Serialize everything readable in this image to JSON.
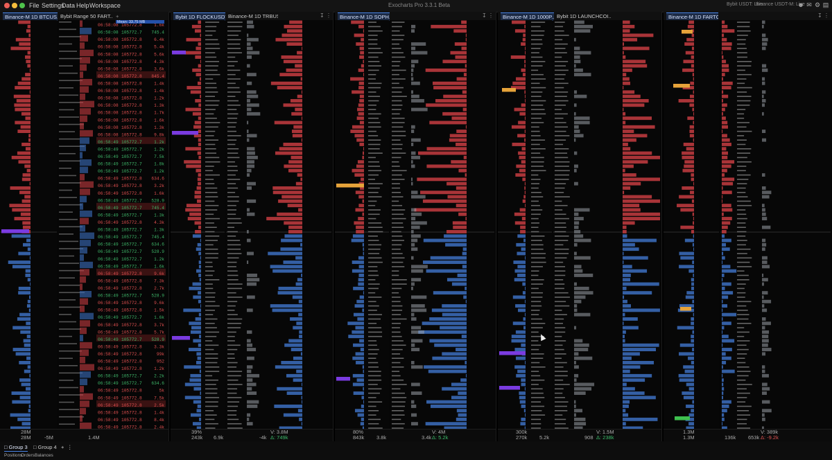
{
  "app": {
    "title": "Exocharts Pro 3.3.1 Beta",
    "menu": [
      "File",
      "Settings",
      "Data",
      "Help",
      "Workspace"
    ],
    "connection_1": "Bybit USDT: Live",
    "connection_2": "Binance USDT-M: Live"
  },
  "colors": {
    "bid": "#4b86d6",
    "ask": "#d4474c",
    "bid_bar": "#3c6fc0",
    "ask_bar": "#c63c41",
    "highlight": "#7a3be0",
    "level_gold": "#e6a33a",
    "level_green": "#3fc04f",
    "sel_border": "#3b6fd8"
  },
  "icons": [
    "close-icon",
    "minimize-icon",
    "maximize-icon",
    "person-icon",
    "bell-icon",
    "gear-icon",
    "layout-icon",
    "window-icon",
    "plus-icon",
    "more-icon",
    "pin-icon",
    "scroll-icon"
  ],
  "panels": [
    {
      "id": "p1",
      "tabs": [
        "Binance-M 1D BTCUS...",
        "Bybit Range 50 FART..."
      ],
      "active": 0,
      "vol_buy_top": "28M",
      "vol_buy_bot": "28M",
      "delta": "-5M",
      "trades_vol": "1.4M",
      "v_label": "",
      "d_label": ""
    },
    {
      "id": "p2",
      "tabs": [
        "Bybit 1D FLOCKUSDT",
        "Binance-M 1D TRBUS..."
      ],
      "active": 0,
      "vol_buy_top": "39%",
      "vol_buy_bot": "243k",
      "delta": "6.9k",
      "trades_vol": "-4k",
      "v_label": "V: 3.8M",
      "d_label": "Δ: 749k"
    },
    {
      "id": "p3",
      "tabs": [
        "Binance-M 1D SOPH..."
      ],
      "active": 0,
      "vol_buy_top": "80%",
      "vol_buy_bot": "843k",
      "delta": "3.8k",
      "trades_vol": "3.4k",
      "v_label": "V: 4M",
      "d_label": "Δ: 5.2k"
    },
    {
      "id": "p4",
      "tabs": [
        "Binance-M 1D 1000P...",
        "Bybit 1D LAUNCHCOI..."
      ],
      "active": 0,
      "vol_buy_top": "300k",
      "vol_buy_bot": "270k",
      "delta": "5.2k",
      "trades_vol": "908",
      "v_label": "V: 1.5M",
      "d_label": "Δ: 238k"
    },
    {
      "id": "p5",
      "tabs": [
        "Binance-M 1D FARTC..."
      ],
      "active": 0,
      "vol_buy_top": "1.3M",
      "vol_buy_bot": "1.3M",
      "delta": "136k",
      "trades_vol": "653k",
      "v_label": "V: 389k",
      "d_label": "Δ: -9.2k"
    }
  ],
  "tape": {
    "header_label": "Mean: 33.75 MB",
    "price": "105772.8",
    "rows": [
      {
        "t": "06:58:08",
        "p": "105772.8",
        "s": "1.6k"
      },
      {
        "t": "06:58:08",
        "p": "105772.7",
        "s": "745.4"
      },
      {
        "t": "06:58:08",
        "p": "105772.8",
        "s": "6.4k"
      },
      {
        "t": "06:58:08",
        "p": "105772.8",
        "s": "5.4k"
      },
      {
        "t": "06:58:08",
        "p": "105772.8",
        "s": "5.6k"
      },
      {
        "t": "06:58:08",
        "p": "105772.8",
        "s": "4.3k"
      },
      {
        "t": "06:58:08",
        "p": "105772.8",
        "s": "3.6k"
      },
      {
        "t": "06:58:08",
        "p": "105772.8",
        "s": "845.4"
      },
      {
        "t": "06:58:08",
        "p": "105772.8",
        "s": "1.4k"
      },
      {
        "t": "06:58:08",
        "p": "105772.8",
        "s": "1.4k"
      },
      {
        "t": "06:58:08",
        "p": "105772.8",
        "s": "1.2k"
      },
      {
        "t": "06:58:08",
        "p": "105772.8",
        "s": "1.3k"
      },
      {
        "t": "06:58:08",
        "p": "105772.8",
        "s": "1.7k"
      },
      {
        "t": "06:58:08",
        "p": "105772.8",
        "s": "1.6k"
      },
      {
        "t": "06:58:08",
        "p": "105772.8",
        "s": "1.3k"
      },
      {
        "t": "06:58:08",
        "p": "105772.8",
        "s": "9.8k"
      },
      {
        "t": "06:58:49",
        "p": "105772.7",
        "s": "1.2k"
      },
      {
        "t": "06:58:49",
        "p": "105772.7",
        "s": "1.2k"
      },
      {
        "t": "06:58:49",
        "p": "105772.7",
        "s": "7.5k"
      },
      {
        "t": "06:58:49",
        "p": "105772.7",
        "s": "1.8k"
      },
      {
        "t": "06:58:49",
        "p": "105772.7",
        "s": "1.2k"
      },
      {
        "t": "06:58:49",
        "p": "105772.8",
        "s": "634.6"
      },
      {
        "t": "06:58:49",
        "p": "105772.8",
        "s": "3.2k"
      },
      {
        "t": "06:58:49",
        "p": "105772.8",
        "s": "1.6k"
      },
      {
        "t": "06:58:49",
        "p": "105772.7",
        "s": "528.9"
      },
      {
        "t": "06:58:49",
        "p": "105772.7",
        "s": "745.4"
      },
      {
        "t": "06:58:49",
        "p": "105772.7",
        "s": "1.3k"
      },
      {
        "t": "06:58:49",
        "p": "105772.8",
        "s": "4.3k"
      },
      {
        "t": "06:58:49",
        "p": "105772.7",
        "s": "1.3k"
      },
      {
        "t": "06:58:49",
        "p": "105772.7",
        "s": "745.4"
      },
      {
        "t": "06:58:49",
        "p": "105772.7",
        "s": "634.6"
      },
      {
        "t": "06:58:49",
        "p": "105772.7",
        "s": "528.9"
      },
      {
        "t": "06:58:49",
        "p": "105772.7",
        "s": "1.2k"
      },
      {
        "t": "06:58:49",
        "p": "105772.7",
        "s": "1.6k"
      },
      {
        "t": "06:58:49",
        "p": "105772.8",
        "s": "9.6k"
      },
      {
        "t": "06:58:49",
        "p": "105772.8",
        "s": "7.3k"
      },
      {
        "t": "06:58:49",
        "p": "105772.8",
        "s": "2.7k"
      },
      {
        "t": "06:58:49",
        "p": "105772.7",
        "s": "528.9"
      },
      {
        "t": "06:58:49",
        "p": "105772.8",
        "s": "9.6k"
      },
      {
        "t": "06:58:49",
        "p": "105772.8",
        "s": "1.5k"
      },
      {
        "t": "06:58:49",
        "p": "105772.7",
        "s": "1.6k"
      },
      {
        "t": "06:58:49",
        "p": "105772.8",
        "s": "3.7k"
      },
      {
        "t": "06:58:49",
        "p": "105772.8",
        "s": "5.7k"
      },
      {
        "t": "06:58:49",
        "p": "105772.7",
        "s": "528.9"
      },
      {
        "t": "06:58:49",
        "p": "105772.8",
        "s": "3.3k"
      },
      {
        "t": "06:58:49",
        "p": "105772.8",
        "s": "99k"
      },
      {
        "t": "06:58:49",
        "p": "105772.8",
        "s": "952"
      },
      {
        "t": "06:58:49",
        "p": "105772.8",
        "s": "1.2k"
      },
      {
        "t": "06:58:49",
        "p": "105772.7",
        "s": "2.2k"
      },
      {
        "t": "06:58:49",
        "p": "105772.7",
        "s": "634.6"
      },
      {
        "t": "06:58:49",
        "p": "105772.8",
        "s": "5k"
      },
      {
        "t": "06:58:49",
        "p": "105772.8",
        "s": "7.5k"
      },
      {
        "t": "06:58:49",
        "p": "105772.8",
        "s": "2.5k"
      },
      {
        "t": "06:58:49",
        "p": "105772.8",
        "s": "1.4k"
      },
      {
        "t": "06:58:49",
        "p": "105772.8",
        "s": "8.4k"
      },
      {
        "t": "06:58:49",
        "p": "105772.8",
        "s": "2.4k"
      }
    ]
  },
  "bottom": {
    "groups": [
      "Group 3",
      "Group 4"
    ],
    "tabs": [
      "Positions",
      "Orders",
      "Balances"
    ]
  }
}
